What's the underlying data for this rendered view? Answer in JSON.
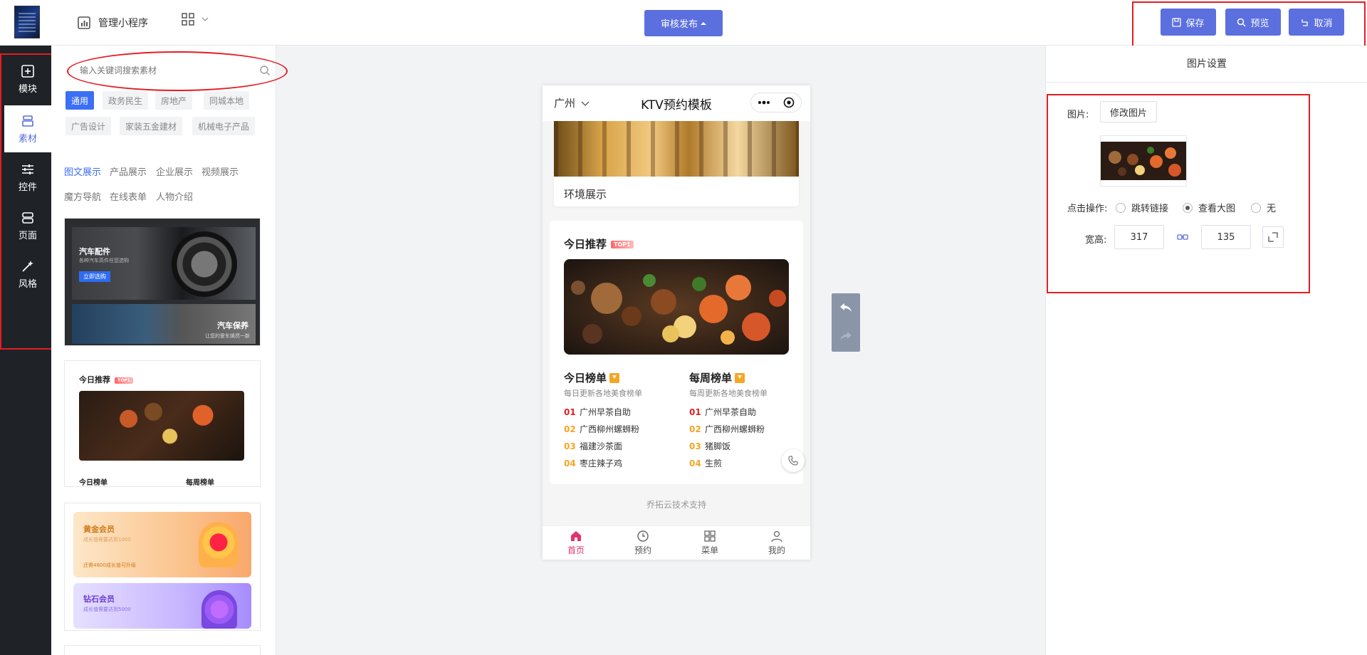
{
  "header": {
    "manage_label": "管理小程序",
    "publish_label": "审核发布",
    "save_label": "保存",
    "preview_label": "预览",
    "cancel_label": "取消"
  },
  "sidebar": {
    "items": [
      {
        "label": "模块",
        "icon": "plus-square-icon"
      },
      {
        "label": "素材",
        "icon": "layers-icon"
      },
      {
        "label": "控件",
        "icon": "sliders-icon"
      },
      {
        "label": "页面",
        "icon": "page-icon"
      },
      {
        "label": "风格",
        "icon": "magic-wand-icon"
      }
    ],
    "active_index": 1
  },
  "material": {
    "search_placeholder": "输入关键词搜索素材",
    "categories": [
      "通用",
      "政务民生",
      "房地产",
      "同城本地",
      "广告设计",
      "家装五金建材",
      "机械电子产品"
    ],
    "subtabs": [
      "图文展示",
      "产品展示",
      "企业展示",
      "视频展示",
      "魔方导航",
      "在线表单",
      "人物介绍"
    ],
    "card1": {
      "title": "汽车配件",
      "sub": "各种汽车高件任您选购",
      "cta": "立即选购",
      "title2": "汽车保养",
      "sub2": "让您的爱车焕然一新"
    },
    "card2": {
      "title": "今日推荐",
      "badge": "TOP1",
      "col1": "今日榜单",
      "col2": "每周榜单"
    },
    "card3": {
      "gold_title": "黄金会员",
      "gold_sub": "成长值需要达到1000",
      "gold_note": "还需4800成长值可升级",
      "diamond_title": "钻石会员",
      "diamond_sub": "成长值需要达到5000"
    }
  },
  "phone": {
    "city": "广州",
    "title": "KTV预约模板",
    "env_label": "环境展示",
    "today_title": "今日推荐",
    "today_badge": "TOP1",
    "daily": {
      "title": "今日榜单",
      "subtitle": "每日更新各地美食榜单",
      "items": [
        {
          "num": "01",
          "name": "广州早茶自助"
        },
        {
          "num": "02",
          "name": "广西柳州螺蛳粉"
        },
        {
          "num": "03",
          "name": "福建沙茶面"
        },
        {
          "num": "04",
          "name": "枣庄辣子鸡"
        }
      ]
    },
    "weekly": {
      "title": "每周榜单",
      "subtitle": "每周更新各地美食榜单",
      "items": [
        {
          "num": "01",
          "name": "广州早茶自助"
        },
        {
          "num": "02",
          "name": "广西柳州螺蛳粉"
        },
        {
          "num": "03",
          "name": "猪脚饭"
        },
        {
          "num": "04",
          "name": "生煎"
        }
      ]
    },
    "support": "乔拓云技术支持",
    "tabs": [
      "首页",
      "预约",
      "菜单",
      "我的"
    ]
  },
  "settings": {
    "title": "图片设置",
    "image_label": "图片:",
    "change_image": "修改图片",
    "click_label": "点击操作:",
    "options": [
      "跳转链接",
      "查看大图",
      "无"
    ],
    "selected_option": "查看大图",
    "size_label": "宽高:",
    "width": "317",
    "height": "135"
  },
  "colors": {
    "accent": "#5b6fdf",
    "highlight": "#e51c23",
    "rank_red": "#e02020",
    "rank_orange": "#f5a623",
    "tab_active": "#e0336f"
  }
}
